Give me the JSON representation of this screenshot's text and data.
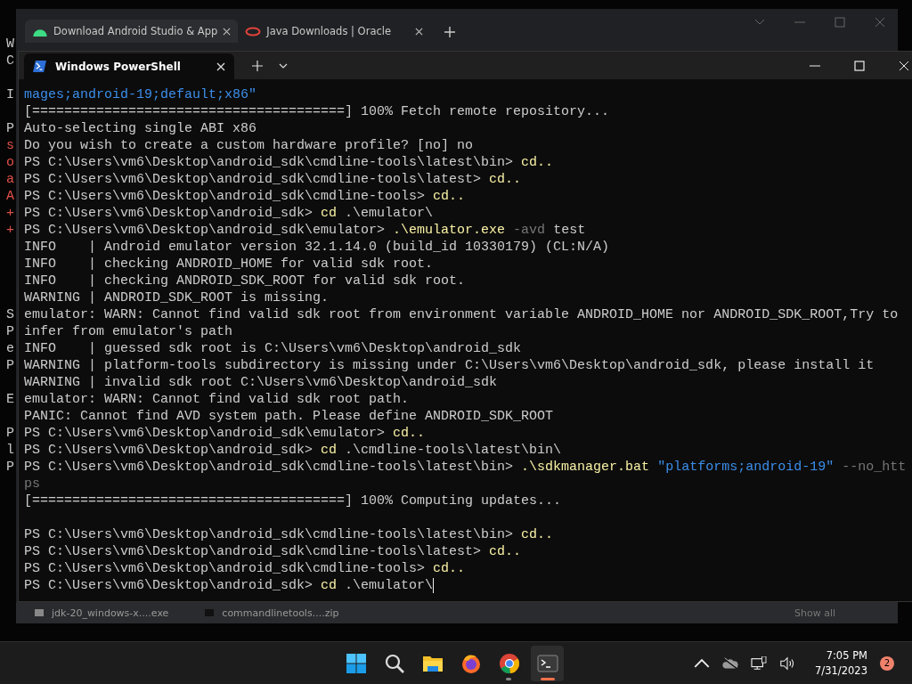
{
  "background_window": {
    "lines": [
      {
        "kind": "text",
        "text": "W",
        "color": "#c8c8c8"
      },
      {
        "kind": "text",
        "text": "C",
        "color": "#c8c8c8"
      },
      {
        "kind": "blank"
      },
      {
        "kind": "text",
        "text": "I",
        "color": "#c8c8c8"
      },
      {
        "kind": "blank"
      },
      {
        "kind": "text",
        "text": "P",
        "color": "#c8c8c8"
      },
      {
        "kind": "text",
        "text": "s",
        "color": "#e0504a"
      },
      {
        "kind": "text",
        "text": "o",
        "color": "#e0504a"
      },
      {
        "kind": "text",
        "text": "a",
        "color": "#e0504a"
      },
      {
        "kind": "text",
        "text": "A",
        "color": "#e0504a"
      },
      {
        "kind": "text",
        "text": "+",
        "color": "#e0504a"
      },
      {
        "kind": "text",
        "text": "+",
        "color": "#e0504a"
      },
      {
        "kind": "blank"
      },
      {
        "kind": "blank"
      },
      {
        "kind": "blank"
      },
      {
        "kind": "blank"
      },
      {
        "kind": "text",
        "text": "S",
        "color": "#c8c8c8"
      },
      {
        "kind": "text",
        "text": "P",
        "color": "#c8c8c8"
      },
      {
        "kind": "text",
        "text": "e",
        "color": "#c8c8c8"
      },
      {
        "kind": "text",
        "text": "P",
        "color": "#c8c8c8"
      },
      {
        "kind": "blank"
      },
      {
        "kind": "text",
        "text": "E",
        "color": "#c8c8c8"
      },
      {
        "kind": "blank"
      },
      {
        "kind": "text",
        "text": "P",
        "color": "#c8c8c8"
      },
      {
        "kind": "text",
        "text": "l",
        "color": "#c8c8c8"
      },
      {
        "kind": "text",
        "text": "P",
        "color": "#c8c8c8"
      }
    ]
  },
  "browser": {
    "tabs": [
      {
        "title": "Download Android Studio & App",
        "kind": "android",
        "selected": true
      },
      {
        "title": "Java Downloads | Oracle",
        "kind": "oracle",
        "selected": false
      }
    ],
    "downloads": [
      {
        "name": "jdk-20_windows-x....exe",
        "kind": "installer"
      },
      {
        "name": "commandlinetools....zip",
        "kind": "archive"
      }
    ],
    "show_all": "Show all"
  },
  "terminal": {
    "tab": {
      "title": "Windows PowerShell",
      "selected": true
    },
    "cursor": true,
    "lines": [
      {
        "kind": "text",
        "segments": [
          {
            "text": "mages;android-19;default;x86\"",
            "kind": "string"
          }
        ]
      },
      {
        "kind": "text",
        "segments": [
          {
            "text": "[=======================================] 100% Fetch remote repository...",
            "kind": "plain"
          }
        ]
      },
      {
        "kind": "text",
        "segments": [
          {
            "text": "Auto-selecting single ABI x86",
            "kind": "plain"
          }
        ]
      },
      {
        "kind": "text",
        "segments": [
          {
            "text": "Do you wish to create a custom hardware profile? [no] no",
            "kind": "plain"
          }
        ]
      },
      {
        "kind": "text",
        "segments": [
          {
            "text": "PS C:\\Users\\vm6\\Desktop\\android_sdk\\cmdline-tools\\latest\\bin> ",
            "kind": "plain"
          },
          {
            "text": "cd..",
            "kind": "command"
          }
        ]
      },
      {
        "kind": "text",
        "segments": [
          {
            "text": "PS C:\\Users\\vm6\\Desktop\\android_sdk\\cmdline-tools\\latest> ",
            "kind": "plain"
          },
          {
            "text": "cd..",
            "kind": "command"
          }
        ]
      },
      {
        "kind": "text",
        "segments": [
          {
            "text": "PS C:\\Users\\vm6\\Desktop\\android_sdk\\cmdline-tools> ",
            "kind": "plain"
          },
          {
            "text": "cd..",
            "kind": "command"
          }
        ]
      },
      {
        "kind": "text",
        "segments": [
          {
            "text": "PS C:\\Users\\vm6\\Desktop\\android_sdk> ",
            "kind": "plain"
          },
          {
            "text": "cd",
            "kind": "command"
          },
          {
            "text": " .\\emulator\\",
            "kind": "plain"
          }
        ]
      },
      {
        "kind": "text",
        "segments": [
          {
            "text": "PS C:\\Users\\vm6\\Desktop\\android_sdk\\emulator> ",
            "kind": "plain"
          },
          {
            "text": ".\\emulator.exe",
            "kind": "command"
          },
          {
            "text": " -avd",
            "kind": "parameter"
          },
          {
            "text": " test",
            "kind": "plain"
          }
        ]
      },
      {
        "kind": "text",
        "segments": [
          {
            "text": "INFO    | Android emulator version 32.1.14.0 (build_id 10330179) (CL:N/A)",
            "kind": "plain"
          }
        ]
      },
      {
        "kind": "text",
        "segments": [
          {
            "text": "INFO    | checking ANDROID_HOME for valid sdk root.",
            "kind": "plain"
          }
        ]
      },
      {
        "kind": "text",
        "segments": [
          {
            "text": "INFO    | checking ANDROID_SDK_ROOT for valid sdk root.",
            "kind": "plain"
          }
        ]
      },
      {
        "kind": "text",
        "segments": [
          {
            "text": "WARNING | ANDROID_SDK_ROOT is missing.",
            "kind": "plain"
          }
        ]
      },
      {
        "kind": "text",
        "segments": [
          {
            "text": "emulator: WARN: Cannot find valid sdk root from environment variable ANDROID_HOME nor ANDROID_SDK_ROOT,Try to",
            "kind": "plain"
          }
        ]
      },
      {
        "kind": "text",
        "segments": [
          {
            "text": "infer from emulator's path",
            "kind": "plain"
          }
        ]
      },
      {
        "kind": "text",
        "segments": [
          {
            "text": "INFO    | guessed sdk root is C:\\Users\\vm6\\Desktop\\android_sdk",
            "kind": "plain"
          }
        ]
      },
      {
        "kind": "text",
        "segments": [
          {
            "text": "WARNING | platform-tools subdirectory is missing under C:\\Users\\vm6\\Desktop\\android_sdk, please install it",
            "kind": "plain"
          }
        ]
      },
      {
        "kind": "text",
        "segments": [
          {
            "text": "WARNING | invalid sdk root C:\\Users\\vm6\\Desktop\\android_sdk",
            "kind": "plain"
          }
        ]
      },
      {
        "kind": "text",
        "segments": [
          {
            "text": "emulator: WARN: Cannot find valid sdk root path.",
            "kind": "plain"
          }
        ]
      },
      {
        "kind": "text",
        "segments": [
          {
            "text": "PANIC: Cannot find AVD system path. Please define ANDROID_SDK_ROOT",
            "kind": "plain"
          }
        ]
      },
      {
        "kind": "text",
        "segments": [
          {
            "text": "PS C:\\Users\\vm6\\Desktop\\android_sdk\\emulator> ",
            "kind": "plain"
          },
          {
            "text": "cd..",
            "kind": "command"
          }
        ]
      },
      {
        "kind": "text",
        "segments": [
          {
            "text": "PS C:\\Users\\vm6\\Desktop\\android_sdk> ",
            "kind": "plain"
          },
          {
            "text": "cd",
            "kind": "command"
          },
          {
            "text": " .\\cmdline-tools\\latest\\bin\\",
            "kind": "plain"
          }
        ]
      },
      {
        "kind": "text",
        "segments": [
          {
            "text": "PS C:\\Users\\vm6\\Desktop\\android_sdk\\cmdline-tools\\latest\\bin> ",
            "kind": "plain"
          },
          {
            "text": ".\\sdkmanager.bat",
            "kind": "command"
          },
          {
            "text": " \"platforms;android-19\"",
            "kind": "string"
          },
          {
            "text": " --no_htt",
            "kind": "parameter"
          }
        ]
      },
      {
        "kind": "text",
        "segments": [
          {
            "text": "ps",
            "kind": "parameter"
          }
        ]
      },
      {
        "kind": "text",
        "segments": [
          {
            "text": "[=======================================] 100% Computing updates...",
            "kind": "plain"
          }
        ]
      },
      {
        "kind": "blank"
      },
      {
        "kind": "text",
        "segments": [
          {
            "text": "PS C:\\Users\\vm6\\Desktop\\android_sdk\\cmdline-tools\\latest\\bin> ",
            "kind": "plain"
          },
          {
            "text": "cd..",
            "kind": "command"
          }
        ]
      },
      {
        "kind": "text",
        "segments": [
          {
            "text": "PS C:\\Users\\vm6\\Desktop\\android_sdk\\cmdline-tools\\latest> ",
            "kind": "plain"
          },
          {
            "text": "cd..",
            "kind": "command"
          }
        ]
      },
      {
        "kind": "text",
        "segments": [
          {
            "text": "PS C:\\Users\\vm6\\Desktop\\android_sdk\\cmdline-tools> ",
            "kind": "plain"
          },
          {
            "text": "cd..",
            "kind": "command"
          }
        ]
      },
      {
        "kind": "text",
        "segments": [
          {
            "text": "PS C:\\Users\\vm6\\Desktop\\android_sdk> ",
            "kind": "plain"
          },
          {
            "text": "cd",
            "kind": "command"
          },
          {
            "text": " .\\emulator\\",
            "kind": "plain"
          }
        ]
      }
    ]
  },
  "taskbar": {
    "apps": [
      {
        "kind": "start",
        "running": false,
        "active": false
      },
      {
        "kind": "search",
        "running": false,
        "active": false
      },
      {
        "kind": "files",
        "running": false,
        "active": false
      },
      {
        "kind": "firefox",
        "running": false,
        "active": false
      },
      {
        "kind": "chrome",
        "running": true,
        "active": false
      },
      {
        "kind": "terminal",
        "running": true,
        "active": true
      }
    ],
    "time": "7:05 PM",
    "date": "7/31/2023",
    "notifications": "2"
  }
}
